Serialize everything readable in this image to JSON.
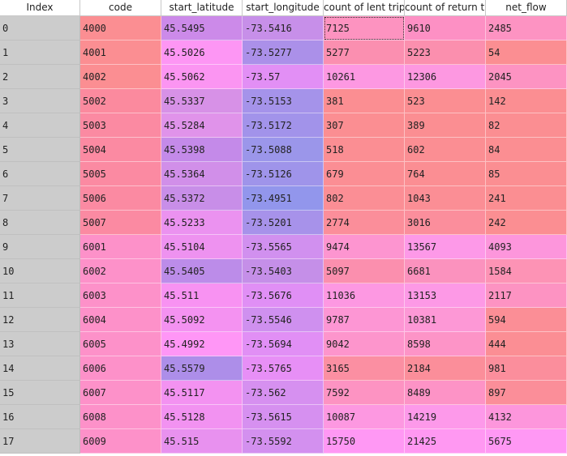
{
  "columns": [
    "Index",
    "code",
    "start_latitude",
    "start_longitude",
    "count of lent trips",
    "count of return trip",
    "net_flow"
  ],
  "rows": [
    {
      "index": "0",
      "code": "4000",
      "lat": "45.5495",
      "lon": "-73.5416",
      "lent": "7125",
      "ret": "9610",
      "net": "2485"
    },
    {
      "index": "1",
      "code": "4001",
      "lat": "45.5026",
      "lon": "-73.5277",
      "lent": "5277",
      "ret": "5223",
      "net": "54"
    },
    {
      "index": "2",
      "code": "4002",
      "lat": "45.5062",
      "lon": "-73.57",
      "lent": "10261",
      "ret": "12306",
      "net": "2045"
    },
    {
      "index": "3",
      "code": "5002",
      "lat": "45.5337",
      "lon": "-73.5153",
      "lent": "381",
      "ret": "523",
      "net": "142"
    },
    {
      "index": "4",
      "code": "5003",
      "lat": "45.5284",
      "lon": "-73.5172",
      "lent": "307",
      "ret": "389",
      "net": "82"
    },
    {
      "index": "5",
      "code": "5004",
      "lat": "45.5398",
      "lon": "-73.5088",
      "lent": "518",
      "ret": "602",
      "net": "84"
    },
    {
      "index": "6",
      "code": "5005",
      "lat": "45.5364",
      "lon": "-73.5126",
      "lent": "679",
      "ret": "764",
      "net": "85"
    },
    {
      "index": "7",
      "code": "5006",
      "lat": "45.5372",
      "lon": "-73.4951",
      "lent": "802",
      "ret": "1043",
      "net": "241"
    },
    {
      "index": "8",
      "code": "5007",
      "lat": "45.5233",
      "lon": "-73.5201",
      "lent": "2774",
      "ret": "3016",
      "net": "242"
    },
    {
      "index": "9",
      "code": "6001",
      "lat": "45.5104",
      "lon": "-73.5565",
      "lent": "9474",
      "ret": "13567",
      "net": "4093"
    },
    {
      "index": "10",
      "code": "6002",
      "lat": "45.5405",
      "lon": "-73.5403",
      "lent": "5097",
      "ret": "6681",
      "net": "1584"
    },
    {
      "index": "11",
      "code": "6003",
      "lat": "45.511",
      "lon": "-73.5676",
      "lent": "11036",
      "ret": "13153",
      "net": "2117"
    },
    {
      "index": "12",
      "code": "6004",
      "lat": "45.5092",
      "lon": "-73.5546",
      "lent": "9787",
      "ret": "10381",
      "net": "594"
    },
    {
      "index": "13",
      "code": "6005",
      "lat": "45.4992",
      "lon": "-73.5694",
      "lent": "9042",
      "ret": "8598",
      "net": "444"
    },
    {
      "index": "14",
      "code": "6006",
      "lat": "45.5579",
      "lon": "-73.5765",
      "lent": "3165",
      "ret": "2184",
      "net": "981"
    },
    {
      "index": "15",
      "code": "6007",
      "lat": "45.5117",
      "lon": "-73.562",
      "lent": "7592",
      "ret": "8489",
      "net": "897"
    },
    {
      "index": "16",
      "code": "6008",
      "lat": "45.5128",
      "lon": "-73.5615",
      "lent": "10087",
      "ret": "14219",
      "net": "4132"
    },
    {
      "index": "17",
      "code": "6009",
      "lat": "45.515",
      "lon": "-73.5592",
      "lent": "15750",
      "ret": "21425",
      "net": "5675"
    }
  ],
  "colors": {
    "code": [
      "#fb8e92",
      "#fb8e92",
      "#fb8e92",
      "#fb8a9e",
      "#fb8aa2",
      "#fb8aa2",
      "#fb8aa2",
      "#fb8aa2",
      "#fb8aa2",
      "#fd91c9",
      "#fd91c9",
      "#fd91c9",
      "#fd91c9",
      "#fd91c9",
      "#fd91c9",
      "#fd91c9",
      "#fd91c9",
      "#fd91c9"
    ],
    "lat": [
      "#cc8ae9",
      "#fd96f4",
      "#fb95f2",
      "#d791e7",
      "#e093ea",
      "#c48ae9",
      "#d18fe9",
      "#c88ee8",
      "#eb92f0",
      "#ee92f0",
      "#bc8ce9",
      "#f892f2",
      "#f492f1",
      "#ff96f6",
      "#ad8ee9",
      "#f392f1",
      "#f292f1",
      "#e891ef"
    ],
    "lon": [
      "#c78fe9",
      "#ab90e9",
      "#e28ff5",
      "#a593ea",
      "#a293ea",
      "#9b96ea",
      "#9f94ea",
      "#9296ec",
      "#a792ea",
      "#d190ef",
      "#c58fe8",
      "#e08ff5",
      "#cf90ef",
      "#e18ff5",
      "#e78ff6",
      "#d690f0",
      "#d690f0",
      "#d390ef"
    ],
    "lent": [
      "#fd93c0",
      "#fb8fb0",
      "#fd98e2",
      "#fb8e92",
      "#fb8e92",
      "#fb8e93",
      "#fb8e94",
      "#fb8e95",
      "#fb8e9a",
      "#fd95d0",
      "#fb8fae",
      "#fd98e2",
      "#fd96d4",
      "#fd95cc",
      "#fb8fa2",
      "#fd93c2",
      "#fd98e1",
      "#ff98f4"
    ],
    "ret": [
      "#fd90c4",
      "#fb8fae",
      "#fd98e1",
      "#fb8e92",
      "#fb8e92",
      "#fb8e93",
      "#fb8e93",
      "#fb8e95",
      "#fb8e9c",
      "#fd99e8",
      "#fb92be",
      "#fd99e6",
      "#fd98d6",
      "#fd94c7",
      "#fb8e9a",
      "#fd93c6",
      "#fd99ea",
      "#ff98f2"
    ],
    "net": [
      "#fd93c2",
      "#fb8e92",
      "#fd93c2",
      "#fb8e92",
      "#fb8e92",
      "#fb8e92",
      "#fb8e92",
      "#fb8e92",
      "#fb8e92",
      "#fd96dc",
      "#fd93b5",
      "#fd93c2",
      "#fb8e96",
      "#fb8e94",
      "#fb8e9c",
      "#fb8e99",
      "#fd96dc",
      "#ff98f4"
    ]
  }
}
